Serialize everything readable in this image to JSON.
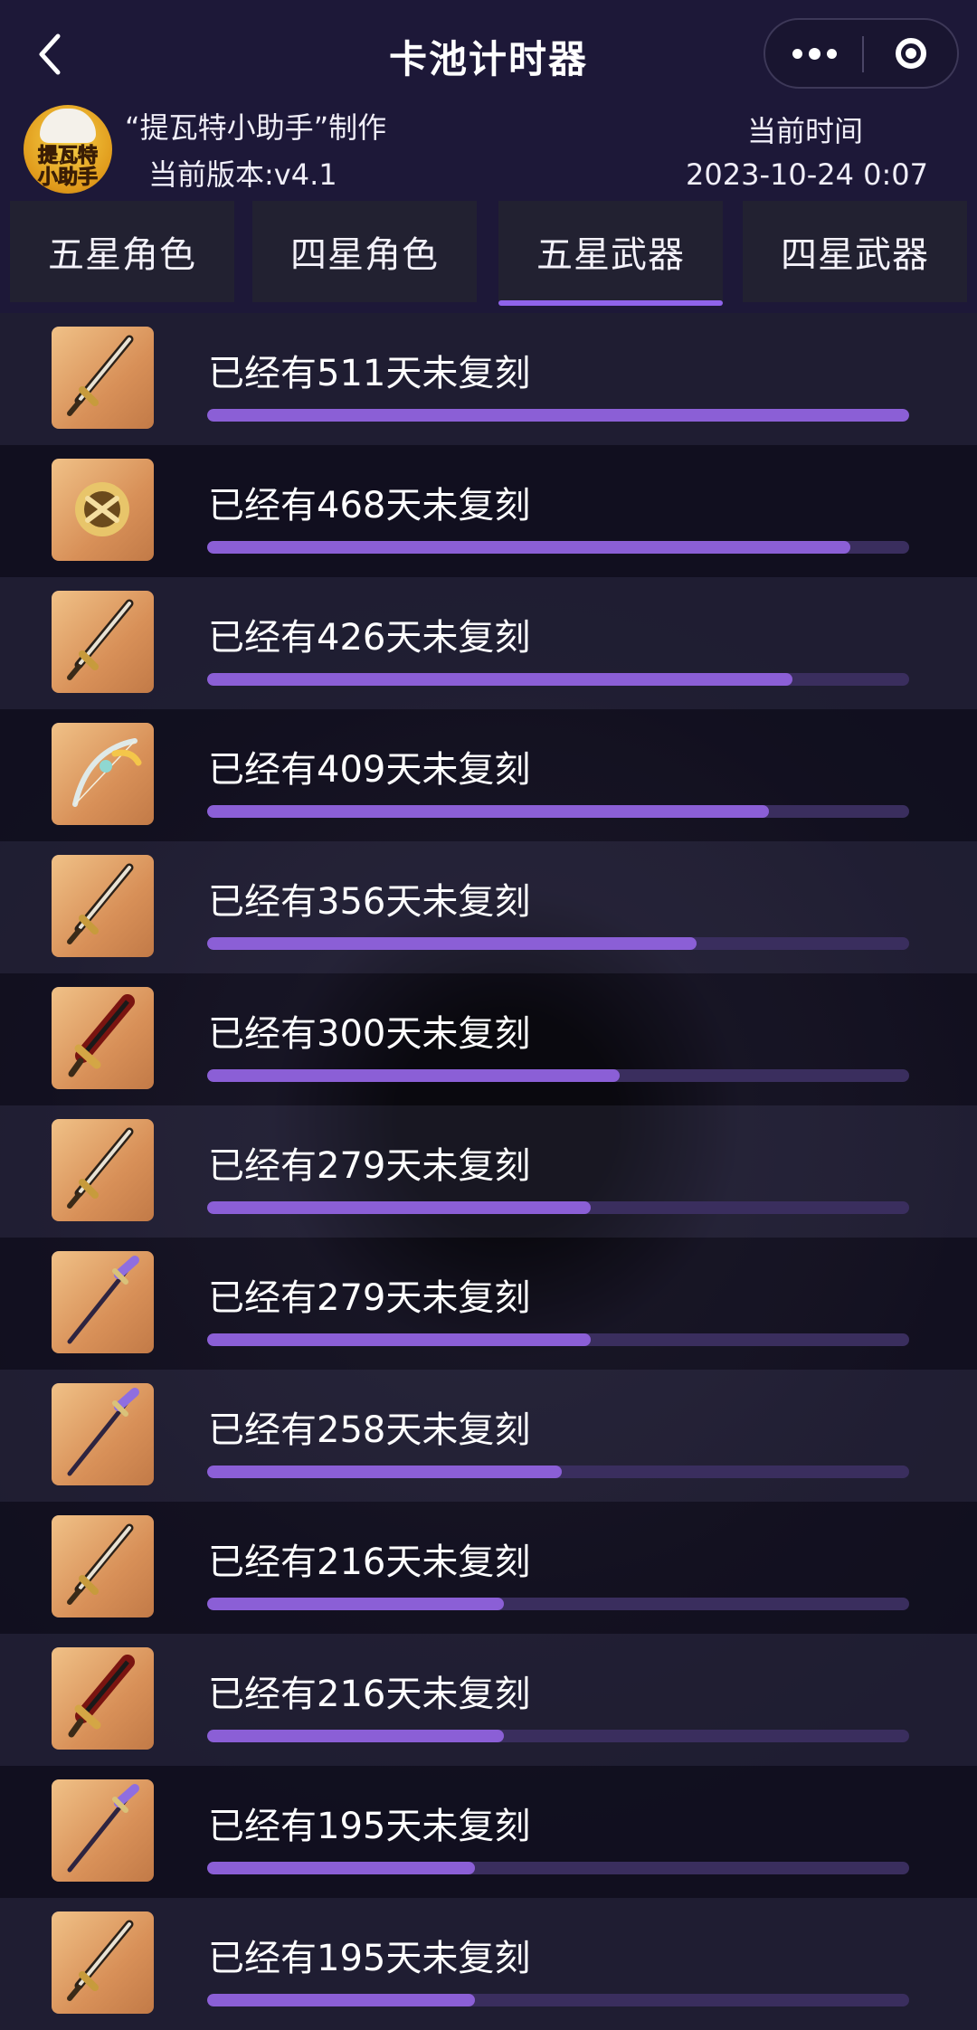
{
  "nav": {
    "title": "卡池计时器",
    "back_icon": "chevron-left-icon",
    "more_icon": "more-dots-icon",
    "close_icon": "target-close-icon"
  },
  "header": {
    "logo_line1": "提瓦特",
    "logo_line2": "小助手",
    "maker": "“提瓦特小助手”制作",
    "version": "当前版本:v4.1",
    "time_label": "当前时间",
    "time_value": "2023-10-24 0:07"
  },
  "tabs": [
    {
      "label": "五星角色",
      "active": false
    },
    {
      "label": "四星角色",
      "active": false
    },
    {
      "label": "五星武器",
      "active": true
    },
    {
      "label": "四星武器",
      "active": false
    }
  ],
  "colors": {
    "accent": "#8b5fd6",
    "track": "#3a2e5e",
    "tile_bg": "#d89058"
  },
  "max_days": 511,
  "weapons": [
    {
      "text": "已经有511天未复刻",
      "days": 511,
      "icon": "sword-icon"
    },
    {
      "text": "已经有468天未复刻",
      "days": 468,
      "icon": "catalyst-icon"
    },
    {
      "text": "已经有426天未复刻",
      "days": 426,
      "icon": "sword-icon"
    },
    {
      "text": "已经有409天未复刻",
      "days": 409,
      "icon": "bow-icon"
    },
    {
      "text": "已经有356天未复刻",
      "days": 356,
      "icon": "sword-icon"
    },
    {
      "text": "已经有300天未复刻",
      "days": 300,
      "icon": "claymore-icon"
    },
    {
      "text": "已经有279天未复刻",
      "days": 279,
      "icon": "sword-icon"
    },
    {
      "text": "已经有279天未复刻",
      "days": 279,
      "icon": "polearm-icon"
    },
    {
      "text": "已经有258天未复刻",
      "days": 258,
      "icon": "polearm-icon"
    },
    {
      "text": "已经有216天未复刻",
      "days": 216,
      "icon": "sword-icon"
    },
    {
      "text": "已经有216天未复刻",
      "days": 216,
      "icon": "claymore-icon"
    },
    {
      "text": "已经有195天未复刻",
      "days": 195,
      "icon": "polearm-icon"
    },
    {
      "text": "已经有195天未复刻",
      "days": 195,
      "icon": "sword-icon"
    }
  ]
}
